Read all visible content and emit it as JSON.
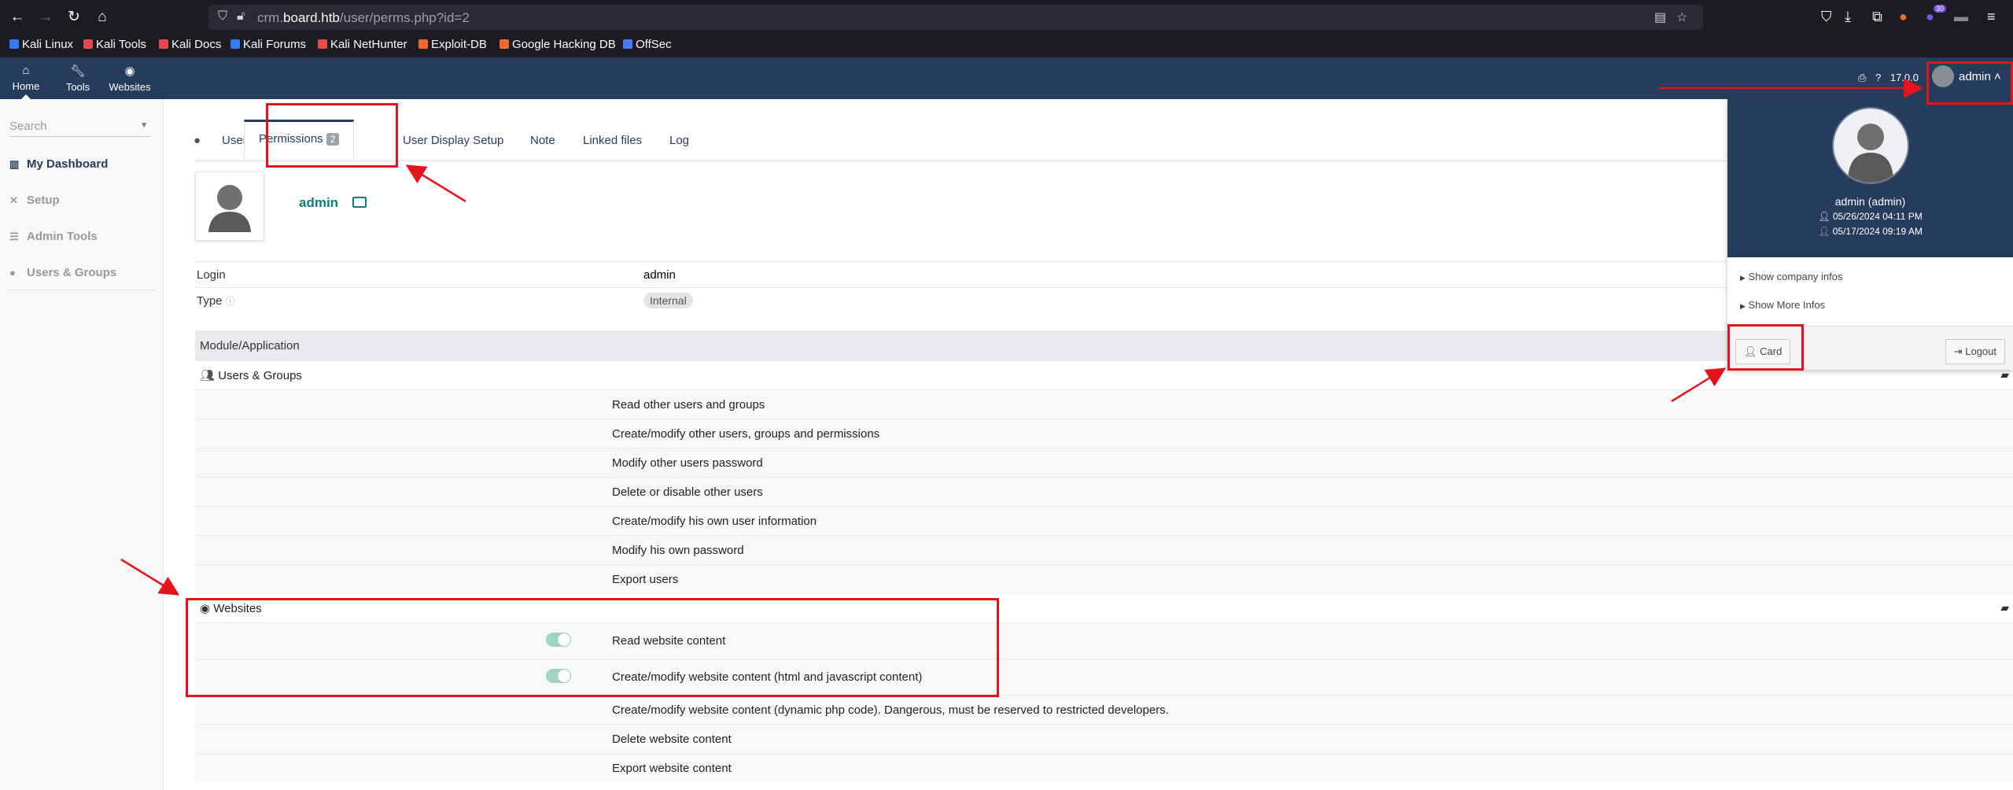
{
  "browser": {
    "url_prefix": "crm.",
    "url_host": "board.htb",
    "url_path": "/user/perms.php?id=2",
    "badge_count": "30",
    "bookmarks": [
      {
        "label": "Kali Linux",
        "color": "#367bf0"
      },
      {
        "label": "Kali Tools",
        "color": "#e64b4b"
      },
      {
        "label": "Kali Docs",
        "color": "#e64b4b"
      },
      {
        "label": "Kali Forums",
        "color": "#367bf0"
      },
      {
        "label": "Kali NetHunter",
        "color": "#e64b4b"
      },
      {
        "label": "Exploit-DB",
        "color": "#f2692d"
      },
      {
        "label": "Google Hacking DB",
        "color": "#f2692d"
      },
      {
        "label": "OffSec",
        "color": "#4c7bf3"
      }
    ]
  },
  "topbar": {
    "menus": [
      {
        "label": "Home",
        "icon": "home-icon"
      },
      {
        "label": "Tools",
        "icon": "wrench-icon"
      },
      {
        "label": "Websites",
        "icon": "globe-icon"
      }
    ],
    "version": "17.0.0",
    "user": "admin"
  },
  "sidebar": {
    "search_placeholder": "Search",
    "items": [
      {
        "label": "My Dashboard",
        "icon": "chart-icon"
      },
      {
        "label": "Setup",
        "icon": "tools-icon"
      },
      {
        "label": "Admin Tools",
        "icon": "list-icon"
      },
      {
        "label": "Users & Groups",
        "icon": "user-icon"
      }
    ]
  },
  "tabs": [
    {
      "label": "User"
    },
    {
      "label": "Permissions",
      "badge": "2"
    },
    {
      "label": "User Display Setup"
    },
    {
      "label": "Note"
    },
    {
      "label": "Linked files"
    },
    {
      "label": "Log"
    }
  ],
  "user": {
    "name": "admin",
    "login_label": "Login",
    "login_value": "admin",
    "type_label": "Type",
    "type_value": "Internal"
  },
  "module_header": "Module/Application",
  "groups": [
    {
      "name": "Users & Groups",
      "perms": [
        "Read other users and groups",
        "Create/modify other users, groups and permissions",
        "Modify other users password",
        "Delete or disable other users",
        "Create/modify his own user information",
        "Modify his own password",
        "Export users"
      ]
    },
    {
      "name": "Websites",
      "perms": [
        {
          "text": "Read website content",
          "enabled": true
        },
        {
          "text": "Create/modify website content (html and javascript content)",
          "enabled": true
        },
        {
          "text": "Create/modify website content (dynamic php code). Dangerous, must be reserved to restricted developers.",
          "enabled": false
        },
        {
          "text": "Delete website content",
          "enabled": false
        },
        {
          "text": "Export website content",
          "enabled": false
        }
      ]
    }
  ],
  "dropdown": {
    "name": "admin (admin)",
    "date1": "05/26/2024 04:11 PM",
    "date2": "05/17/2024 09:19 AM",
    "link1": "Show company infos",
    "link2": "Show More Infos",
    "card": "Card",
    "logout": "Logout"
  },
  "colors": {
    "topbar": "#263c5c",
    "annotation": "#e3141b",
    "toggle_on": "#9fd4c3"
  }
}
